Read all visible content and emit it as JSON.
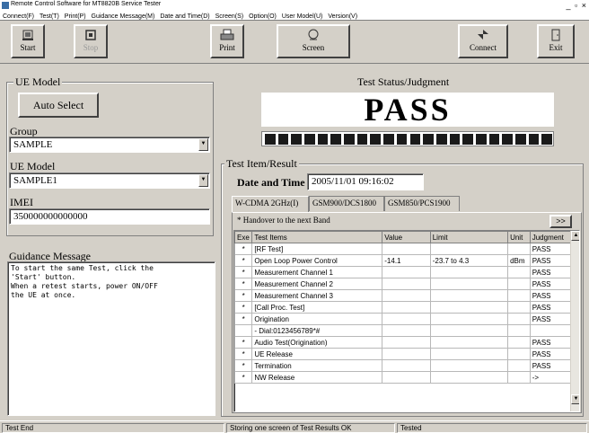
{
  "window": {
    "title": "Remote Control Software for MT8820B Service Tester",
    "controls": [
      "_",
      "▫",
      "×"
    ]
  },
  "menu": [
    "Connect(F)",
    "Test(T)",
    "Print(P)",
    "Guidance Message(M)",
    "Date and Time(D)",
    "Screen(S)",
    "Option(O)",
    "User Model(U)",
    "Version(V)"
  ],
  "toolbar": {
    "start": "Start",
    "stop": "Stop",
    "print": "Print",
    "screen": "Screen",
    "connect": "Connect",
    "exit": "Exit"
  },
  "ue_model": {
    "group_title": "UE Model",
    "auto_select_label": "Auto Select",
    "group_label": "Group",
    "group_value": "SAMPLE",
    "model_label": "UE Model",
    "model_value": "SAMPLE1",
    "imei_label": "IMEI",
    "imei_value": "350000000000000"
  },
  "guidance": {
    "title": "Guidance Message",
    "lines": [
      "To start the same Test, click the",
      "'Start' button.",
      "When a retest starts, power ON/OFF",
      "the UE at once."
    ]
  },
  "status": {
    "title": "Test Status/Judgment",
    "judgment": "PASS",
    "progress_segments": 22,
    "colors": {
      "segment": "#1a1a1a",
      "background": "#ffffff"
    }
  },
  "result": {
    "group_title": "Test Item/Result",
    "date_label": "Date and Time",
    "date_value": "2005/11/01 09:16:02",
    "tabs": [
      "W-CDMA 2GHz(I)",
      "GSM900/DCS1800",
      "GSM850/PCS1900"
    ],
    "handover_text": "* Handover to the next Band",
    "next_button": ">>",
    "columns": [
      "Exe",
      "Test Items",
      "Value",
      "Limit",
      "Unit",
      "Judgment"
    ],
    "rows": [
      {
        "exe": "*",
        "item": "[RF Test]",
        "value": "",
        "limit": "",
        "unit": "",
        "judgment": "PASS"
      },
      {
        "exe": "*",
        "item": "Open Loop Power Control",
        "value": "-14.1",
        "limit": "-23.7 to 4.3",
        "unit": "dBm",
        "judgment": "PASS"
      },
      {
        "exe": "*",
        "item": "Measurement Channel 1",
        "value": "",
        "limit": "",
        "unit": "",
        "judgment": "PASS"
      },
      {
        "exe": "*",
        "item": "Measurement Channel 2",
        "value": "",
        "limit": "",
        "unit": "",
        "judgment": "PASS"
      },
      {
        "exe": "*",
        "item": "Measurement Channel 3",
        "value": "",
        "limit": "",
        "unit": "",
        "judgment": "PASS"
      },
      {
        "exe": "*",
        "item": "[Call Proc. Test]",
        "value": "",
        "limit": "",
        "unit": "",
        "judgment": "PASS"
      },
      {
        "exe": "*",
        "item": "Origination",
        "value": "",
        "limit": "",
        "unit": "",
        "judgment": "PASS"
      },
      {
        "exe": "",
        "item": " - Dial:0123456789*#",
        "value": "",
        "limit": "",
        "unit": "",
        "judgment": ""
      },
      {
        "exe": "*",
        "item": "Audio Test(Origination)",
        "value": "",
        "limit": "",
        "unit": "",
        "judgment": "PASS"
      },
      {
        "exe": "*",
        "item": "UE Release",
        "value": "",
        "limit": "",
        "unit": "",
        "judgment": "PASS"
      },
      {
        "exe": "*",
        "item": "Termination",
        "value": "",
        "limit": "",
        "unit": "",
        "judgment": "PASS"
      },
      {
        "exe": "*",
        "item": "NW Release",
        "value": "",
        "limit": "",
        "unit": "",
        "judgment": "->"
      }
    ]
  },
  "statusbar": {
    "left": "Test End",
    "middle": "Storing one screen of Test Results OK",
    "right": "Tested"
  }
}
